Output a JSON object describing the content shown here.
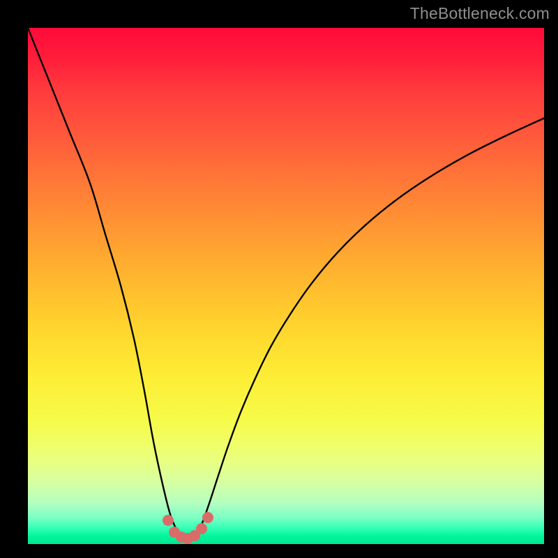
{
  "watermark": "TheBottleneck.com",
  "chart_data": {
    "type": "line",
    "title": "",
    "xlabel": "",
    "ylabel": "",
    "xlim": [
      0,
      100
    ],
    "ylim": [
      0,
      100
    ],
    "series": [
      {
        "name": "curve",
        "color": "#000000",
        "x": [
          0,
          4,
          8,
          12,
          15,
          18,
          20.5,
          22.5,
          24.3,
          26,
          27.5,
          28.8,
          30,
          31,
          32,
          33.4,
          35,
          36.8,
          38.8,
          41.2,
          44,
          47.2,
          51,
          55.2,
          60,
          65.4,
          71.4,
          78,
          85.2,
          93,
          100
        ],
        "y": [
          100,
          90,
          80,
          70,
          60,
          50,
          40,
          30,
          20,
          12,
          6,
          2.8,
          1.4,
          1.1,
          1.4,
          3.2,
          7.5,
          13,
          19,
          25.5,
          32,
          38.5,
          44.8,
          50.8,
          56.5,
          61.8,
          66.7,
          71.2,
          75.4,
          79.3,
          82.5
        ]
      }
    ],
    "markers": {
      "name": "highlight-dots",
      "color": "#d96c69",
      "points": [
        {
          "x": 27.2,
          "y": 4.6
        },
        {
          "x": 28.4,
          "y": 2.3
        },
        {
          "x": 29.7,
          "y": 1.3
        },
        {
          "x": 31.0,
          "y": 1.1
        },
        {
          "x": 32.3,
          "y": 1.6
        },
        {
          "x": 33.6,
          "y": 3.0
        },
        {
          "x": 34.8,
          "y": 5.2
        }
      ]
    },
    "gradient_stops": [
      {
        "pos": 0,
        "color": "#ff0a3a"
      },
      {
        "pos": 50,
        "color": "#ffb530"
      },
      {
        "pos": 80,
        "color": "#f2fe55"
      },
      {
        "pos": 100,
        "color": "#00e88f"
      }
    ]
  }
}
